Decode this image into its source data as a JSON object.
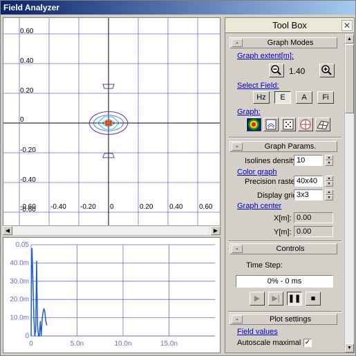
{
  "window": {
    "title": "Field Analyzer"
  },
  "plot": {
    "y_ticks": [
      "0.60",
      "0.40",
      "0.20",
      "0",
      "-0.20",
      "-0.40",
      "-0.60"
    ],
    "x_ticks": [
      "-0.60",
      "-0.40",
      "-0.20",
      "0",
      "0.20",
      "0.40",
      "0.60"
    ]
  },
  "time_plot": {
    "y_ticks": [
      "0.05",
      "40.0m",
      "30.0m",
      "20.0m",
      "10.0m",
      "0"
    ],
    "x_ticks": [
      "0",
      "5.0n",
      "10.0n",
      "15.0n"
    ]
  },
  "chart_data": {
    "type": "line",
    "title": "",
    "xlabel": "",
    "ylabel": "",
    "ylim": [
      0,
      0.05
    ],
    "xlim": [
      0,
      20
    ],
    "series": [
      {
        "x": [
          0,
          0.05,
          0.1,
          0.2,
          0.3,
          0.4,
          0.5,
          0.55,
          0.6,
          0.65,
          0.7,
          0.8,
          0.9,
          1.0,
          1.1,
          1.2,
          1.3,
          1.4,
          1.5,
          1.6,
          1.7
        ],
        "y": [
          0,
          0.04,
          0.048,
          0.03,
          0.01,
          0.0,
          0.003,
          0.022,
          0.041,
          0.022,
          0.006,
          0.0,
          0.0,
          0.008,
          0.0,
          0.009,
          0.013,
          0.015,
          0.013,
          0.008,
          0.006
        ],
        "color": "#1e5bd9"
      }
    ]
  },
  "toolbox": {
    "title": "Tool Box",
    "close": "✕",
    "graph_modes": {
      "title": "Graph Modes",
      "extent_label": "Graph extent[m]:",
      "extent_value": "1.40",
      "select_field_label": "Select Field:",
      "field_buttons": [
        "Hz",
        "E",
        "A",
        "Fi"
      ],
      "selected_field": "E",
      "graph_label": "Graph:"
    },
    "graph_params": {
      "title": "Graph Params.",
      "isolines_label": "Isolines density:",
      "isolines_value": "10",
      "color_graph_label": "Color graph",
      "precision_label": "Precision raster:",
      "precision_value": "40x40",
      "display_grid_label": "Display grid:",
      "display_grid_value": "3x3",
      "graph_center_label": "Graph center",
      "x_label": "X[m]:",
      "x_value": "0.00",
      "y_label": "Y[m]:",
      "y_value": "0.00"
    },
    "controls": {
      "title": "Controls",
      "time_step_label": "Time Step:",
      "progress_text": "0% - 0 ms",
      "progress_fraction": 0.0
    },
    "plot_settings": {
      "title": "Plot settings",
      "field_values_label": "Field values",
      "autoscale_label": "Autoscale maximal",
      "autoscale_checked": true
    }
  },
  "colors": {
    "grid": "#6a6ad8",
    "axis": "#000000",
    "contour": "#6b2fb0",
    "signal": "#1e5bd9"
  }
}
